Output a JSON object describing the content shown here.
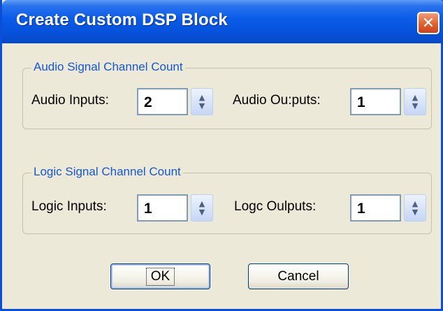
{
  "window": {
    "title": "Create Custom DSP Block",
    "close_symbol": "✕"
  },
  "audio_group": {
    "legend": "Audio Signal Channel Count",
    "inputs_label": "Audio Inputs:",
    "inputs_value": "2",
    "outputs_label": "Audio Ou:puts:",
    "outputs_value": "1"
  },
  "logic_group": {
    "legend": "Logic Signal Channel Count",
    "inputs_label": "Logic Inputs:",
    "inputs_value": "1",
    "outputs_label": "Logc Oulputs:",
    "outputs_value": "1"
  },
  "buttons": {
    "ok_label": "OK",
    "cancel_label": "Cancel"
  },
  "icons": {
    "spin_up": "▲",
    "spin_down": "▼"
  },
  "colors": {
    "titlebar": "#0653dd",
    "legend_text": "#1557d3",
    "dialog_bg": "#ece9d8"
  }
}
